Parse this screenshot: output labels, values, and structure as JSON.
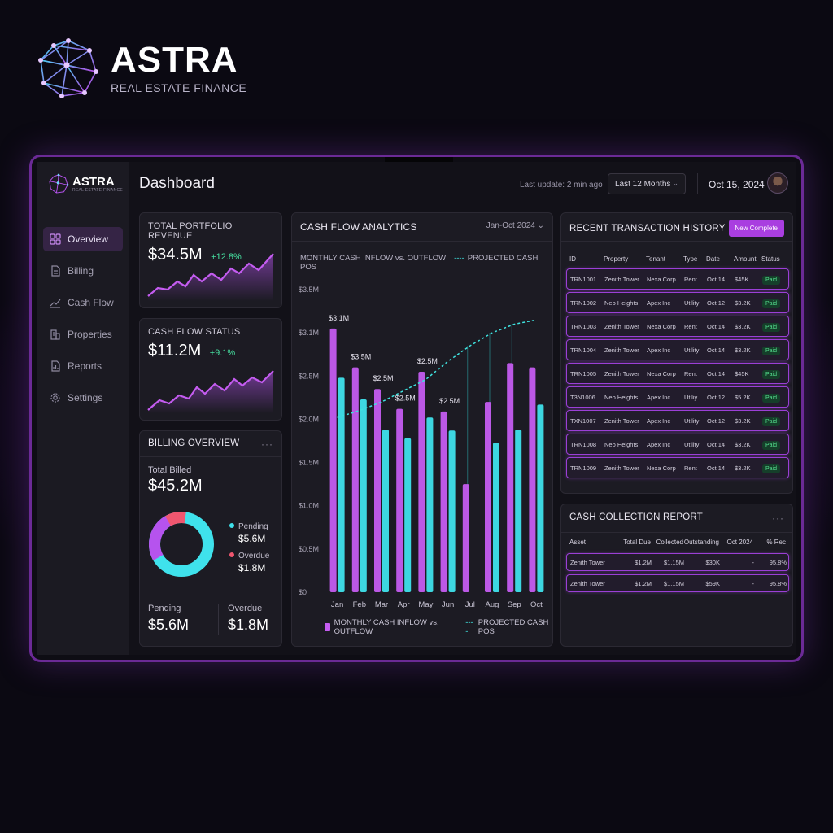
{
  "brand": {
    "name": "ASTRA",
    "subtitle": "REAL ESTATE FINANCE"
  },
  "sidebar": {
    "brand_name": "ASTRA",
    "brand_sub": "REAL ESTATE FINANCE",
    "items": [
      {
        "label": "Overview",
        "icon": "grid-icon",
        "active": true
      },
      {
        "label": "Billing",
        "icon": "document-icon"
      },
      {
        "label": "Cash Flow",
        "icon": "trend-icon"
      },
      {
        "label": "Properties",
        "icon": "building-icon"
      },
      {
        "label": "Reports",
        "icon": "report-icon"
      },
      {
        "label": "Settings",
        "icon": "gear-icon"
      }
    ]
  },
  "header": {
    "title": "Dashboard",
    "last_update": "Last update: 2 min ago",
    "range": "Last 12 Months",
    "date": "Oct 15, 2024"
  },
  "kpis": [
    {
      "title": "TOTAL PORTFOLIO REVENUE",
      "value": "$34.5M",
      "delta": "+12.8%"
    },
    {
      "title": "CASH FLOW STATUS",
      "value": "$11.2M",
      "delta": "+9.1%"
    }
  ],
  "billing": {
    "title": "BILLING OVERVIEW",
    "more": "···",
    "total_label": "Total Billed",
    "total_value": "$45.2M",
    "pending_label": "Pending",
    "pending_value": "$5.6M",
    "overdue_label": "Overdue",
    "overdue_value": "$1.8M",
    "colors": {
      "pending": "#3fe2ec",
      "overdue": "#f0566f",
      "billed": "#b653ee"
    }
  },
  "cashflow": {
    "title": "CASH FLOW ANALYTICS",
    "range": "Jan-Oct 2024",
    "legend_bars": "MONTHLY CASH INFLOW vs. OUTFLOW",
    "legend_line": "PROJECTED CASH POS"
  },
  "chart_data": {
    "type": "bar",
    "categories": [
      "Jan",
      "Feb",
      "Mar",
      "Apr",
      "May",
      "Jun",
      "Jul",
      "Aug",
      "Sep",
      "Oct"
    ],
    "series": [
      {
        "values": [
          3.05,
          2.6,
          2.35,
          2.12,
          2.55,
          2.09,
          1.25,
          2.2,
          2.65,
          2.6
        ],
        "color": "#c45cf0"
      },
      {
        "values": [
          2.48,
          2.23,
          1.88,
          1.78,
          2.02,
          1.87,
          null,
          1.73,
          1.88,
          2.17
        ],
        "color": "#3fe2ec"
      },
      {
        "name": "PROJECTED CASH POS",
        "type": "line",
        "values": [
          2.02,
          2.1,
          2.2,
          2.33,
          2.46,
          2.67,
          2.85,
          3.0,
          3.1,
          3.15
        ],
        "color": "#3fe2df"
      }
    ],
    "data_labels": [
      {
        "category": "Jan",
        "text": "$3.1M"
      },
      {
        "category": "Feb",
        "text": "$3.5M"
      },
      {
        "category": "Mar",
        "text": "$2.5M"
      },
      {
        "category": "Apr",
        "text": "$2.5M"
      },
      {
        "category": "May",
        "text": "$2.5M"
      },
      {
        "category": "Jun",
        "text": "$2.5M"
      }
    ],
    "yticks": [
      "$0",
      "$0.5M",
      "$1.0M",
      "$1.5M",
      "$2.0M",
      "$2.5M",
      "$3.1M",
      "$3.5M"
    ],
    "ylim": [
      0,
      3.5
    ]
  },
  "transactions": {
    "title": "RECENT TRANSACTION HISTORY",
    "button": "New Complete",
    "columns": [
      "ID",
      "Property",
      "Tenant",
      "Type",
      "Date",
      "Amount",
      "Status"
    ],
    "rows": [
      [
        "TRN1001",
        "Zenith Tower",
        "Nexa Corp",
        "Rent",
        "Oct 14",
        "$45K",
        "Paid"
      ],
      [
        "TRN1002",
        "Neo Heights",
        "Apex Inc",
        "Utility",
        "Oct 12",
        "$3.2K",
        "Paid"
      ],
      [
        "TRN1003",
        "Zenith Tower",
        "Nexa Corp",
        "Rent",
        "Oct 14",
        "$3.2K",
        "Paid"
      ],
      [
        "TRN1004",
        "Zenith Tower",
        "Apex Inc",
        "Utility",
        "Oct 14",
        "$3.2K",
        "Paid"
      ],
      [
        "TRN1005",
        "Zenith Tower",
        "Nexa Corp",
        "Rent",
        "Oct 14",
        "$45K",
        "Paid"
      ],
      [
        "T3N1006",
        "Neo Heights",
        "Apex Inc",
        "Utiliy",
        "Oct 12",
        "$5.2K",
        "Paid"
      ],
      [
        "TXN1007",
        "Zenith Tower",
        "Apex Inc",
        "Utility",
        "Oct 12",
        "$3.2K",
        "Paid"
      ],
      [
        "TRN1008",
        "Neo Heights",
        "Apex Inc",
        "Utility",
        "Oct 14",
        "$3.2K",
        "Paid"
      ],
      [
        "TRN1009",
        "Zenith Tower",
        "Nexa Corp",
        "Rent",
        "Oct 14",
        "$3.2K",
        "Paid"
      ]
    ]
  },
  "collections": {
    "title": "CASH COLLECTION REPORT",
    "more": "···",
    "columns": [
      "Asset",
      "Total Due",
      "Collected",
      "Outstanding",
      "Oct 2024",
      "% Rec"
    ],
    "rows": [
      [
        "Zenith Tower",
        "$1.2M",
        "$1.15M",
        "$30K",
        "-",
        "95.8%"
      ],
      [
        "Zenith Tower",
        "$1.2M",
        "$1.15M",
        "$59K",
        "-",
        "95.8%"
      ]
    ]
  }
}
